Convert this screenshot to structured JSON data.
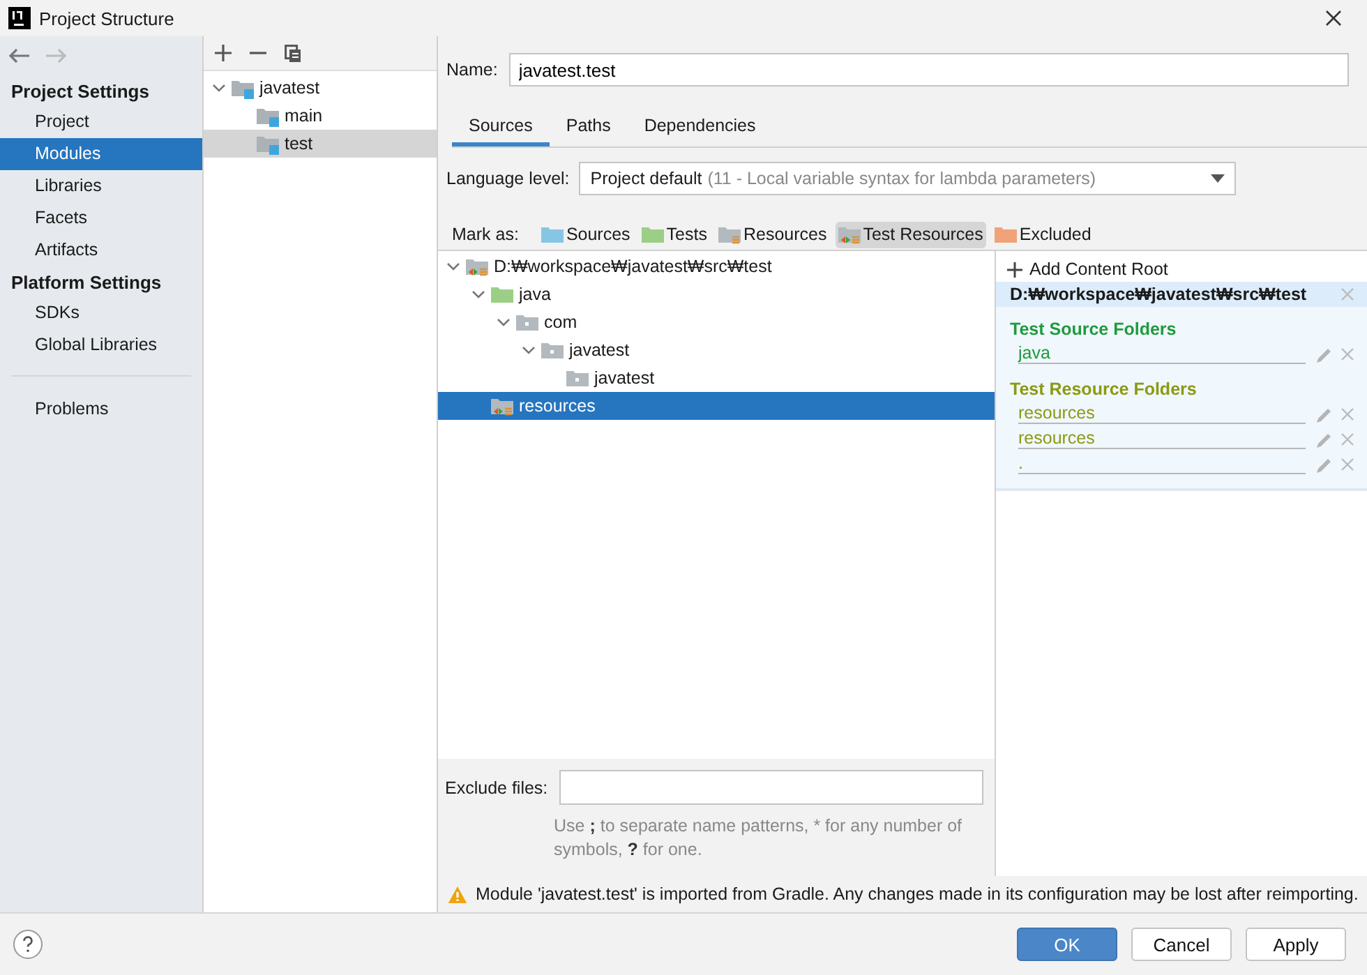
{
  "window": {
    "title": "Project Structure"
  },
  "sidebar": {
    "sections": [
      {
        "title": "Project Settings",
        "items": [
          {
            "label": "Project",
            "selected": false
          },
          {
            "label": "Modules",
            "selected": true
          },
          {
            "label": "Libraries",
            "selected": false
          },
          {
            "label": "Facets",
            "selected": false
          },
          {
            "label": "Artifacts",
            "selected": false
          }
        ]
      },
      {
        "title": "Platform Settings",
        "items": [
          {
            "label": "SDKs",
            "selected": false
          },
          {
            "label": "Global Libraries",
            "selected": false
          }
        ]
      }
    ],
    "bottom_items": [
      {
        "label": "Problems",
        "selected": false
      }
    ]
  },
  "modules": {
    "tree": [
      {
        "label": "javatest",
        "expanded": true,
        "selected": false,
        "children": [
          {
            "label": "main",
            "selected": false
          },
          {
            "label": "test",
            "selected": true
          }
        ]
      }
    ]
  },
  "name_field": {
    "label": "Name:",
    "value": "javatest.test"
  },
  "tabs": [
    {
      "label": "Sources",
      "selected": true
    },
    {
      "label": "Paths",
      "selected": false
    },
    {
      "label": "Dependencies",
      "selected": false
    }
  ],
  "language_level": {
    "label": "Language level:",
    "value": "Project default",
    "hint": "(11 - Local variable syntax for lambda parameters)"
  },
  "mark_as": {
    "label": "Mark as:",
    "buttons": [
      {
        "label": "Sources",
        "kind": "sources",
        "selected": false
      },
      {
        "label": "Tests",
        "kind": "tests",
        "selected": false
      },
      {
        "label": "Resources",
        "kind": "resources",
        "selected": false
      },
      {
        "label": "Test Resources",
        "kind": "testresources",
        "selected": true
      },
      {
        "label": "Excluded",
        "kind": "excluded",
        "selected": false
      }
    ]
  },
  "content_tree": [
    {
      "label": "D:₩workspace₩javatest₩src₩test",
      "kind": "testresources",
      "expanded": true,
      "selected": false,
      "children": [
        {
          "label": "java",
          "kind": "tests",
          "expanded": true,
          "selected": false,
          "children": [
            {
              "label": "com",
              "kind": "package",
              "expanded": true,
              "selected": false,
              "children": [
                {
                  "label": "javatest",
                  "kind": "package",
                  "expanded": true,
                  "selected": false,
                  "children": [
                    {
                      "label": "javatest",
                      "kind": "package",
                      "selected": false
                    }
                  ]
                }
              ]
            }
          ]
        },
        {
          "label": "resources",
          "kind": "testresources",
          "selected": true
        }
      ]
    }
  ],
  "content_root": {
    "add_label": "Add Content Root",
    "path": "D:₩workspace₩javatest₩src₩test",
    "groups": [
      {
        "title": "Test Source Folders",
        "color": "#1e9b3c",
        "folders": [
          "java"
        ]
      },
      {
        "title": "Test Resource Folders",
        "color": "#8a9a12",
        "folders": [
          "resources",
          "resources",
          "."
        ]
      }
    ]
  },
  "exclude_files": {
    "label": "Exclude files:",
    "value_hint": "Use **;** to separate name patterns, * for any number of symbols, **?** for one."
  },
  "warning": "Module 'javatest.test' is imported from Gradle. Any changes made in its configuration may be lost after reimporting.",
  "buttons": [
    {
      "label": "OK",
      "kind": "primary"
    },
    {
      "label": "Cancel",
      "kind": "normal"
    },
    {
      "label": "Apply",
      "kind": "normal"
    }
  ]
}
